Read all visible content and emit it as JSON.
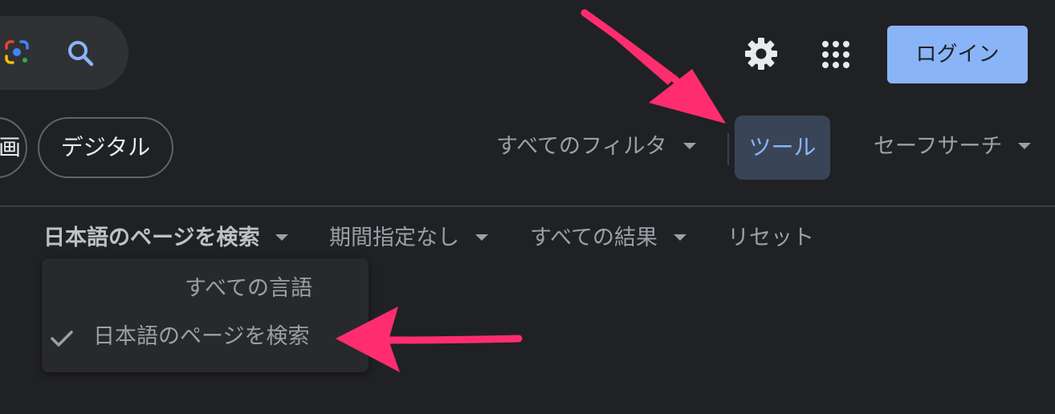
{
  "header": {
    "login_label": "ログイン",
    "icons": {
      "lens": "google-lens-icon",
      "search": "search-icon",
      "settings": "gear-icon",
      "apps": "apps-grid-icon"
    }
  },
  "chips": [
    {
      "label": "画"
    },
    {
      "label": "デジタル"
    }
  ],
  "filters": {
    "all_filters_label": "すべてのフィルタ",
    "tools_label": "ツール",
    "safesearch_label": "セーフサーチ"
  },
  "tools_row": {
    "language_label": "日本語のページを検索",
    "period_label": "期間指定なし",
    "results_label": "すべての結果",
    "reset_label": "リセット"
  },
  "language_menu": {
    "options": [
      {
        "label": "すべての言語",
        "selected": false
      },
      {
        "label": "日本語のページを検索",
        "selected": true
      }
    ]
  },
  "colors": {
    "background": "#202124",
    "accent_blue": "#8ab4f8",
    "annotation_arrow": "#ff2d6f"
  }
}
